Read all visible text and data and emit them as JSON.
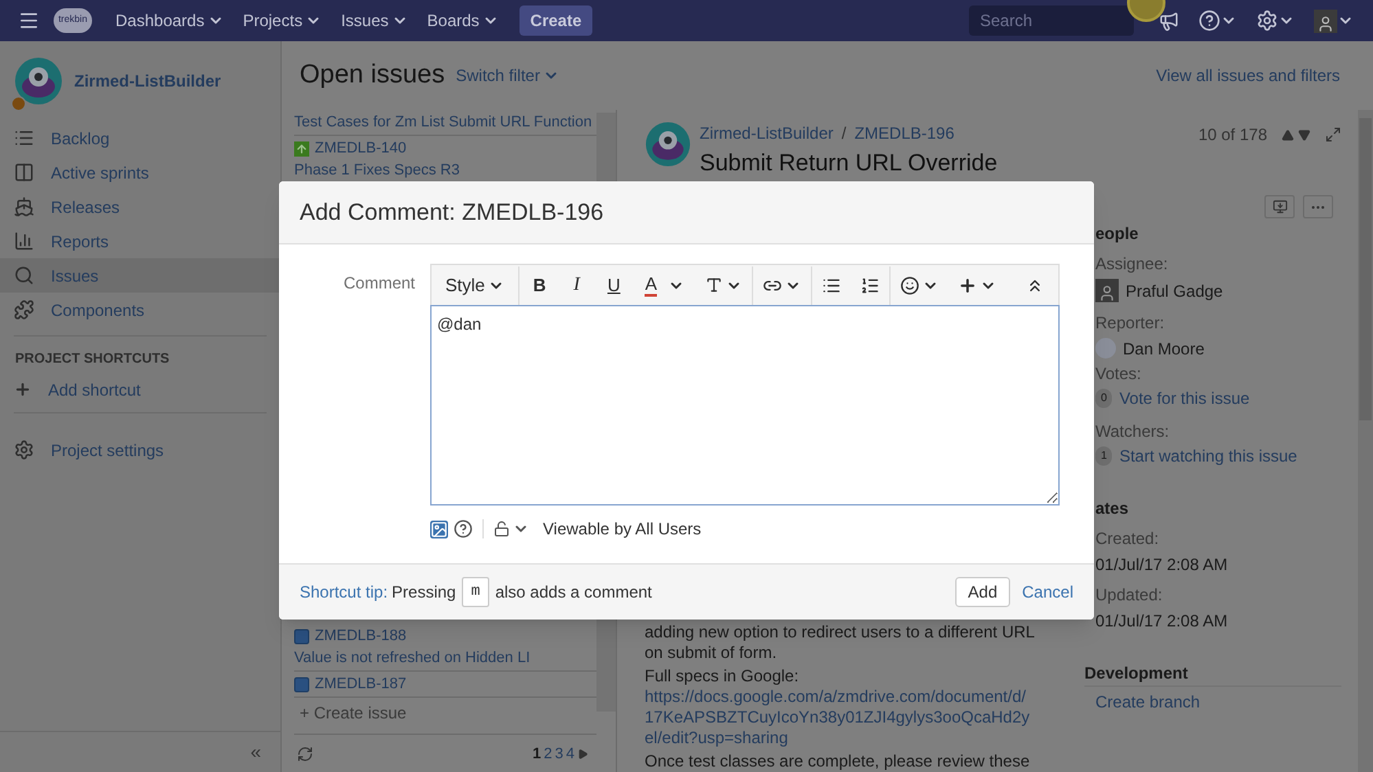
{
  "nav": {
    "logo_text": "trekbin",
    "menus": [
      {
        "label": "Dashboards"
      },
      {
        "label": "Projects"
      },
      {
        "label": "Issues"
      },
      {
        "label": "Boards"
      }
    ],
    "create": "Create",
    "search_placeholder": "Search"
  },
  "sidebar": {
    "project": "Zirmed-ListBuilder",
    "items": [
      {
        "label": "Backlog",
        "selected": false
      },
      {
        "label": "Active sprints",
        "selected": false
      },
      {
        "label": "Releases",
        "selected": false
      },
      {
        "label": "Reports",
        "selected": false
      },
      {
        "label": "Issues",
        "selected": true
      },
      {
        "label": "Components",
        "selected": false
      }
    ],
    "shortcuts_heading": "PROJECT SHORTCUTS",
    "add_shortcut": "Add shortcut",
    "settings": "Project settings",
    "collapse": "«"
  },
  "header": {
    "title": "Open issues",
    "switch_filter": "Switch filter",
    "view_all": "View all issues and filters"
  },
  "issue_list": {
    "top_items": [
      {
        "summary": "Test Cases for Zm List Submit URL Function"
      },
      {
        "key": "ZMEDLB-140",
        "kind": "story",
        "summary": "Phase 1 Fixes Specs R3"
      }
    ],
    "bottom_items": [
      {
        "key": "ZMEDLB-188",
        "kind": "task",
        "summary": "Value is not refreshed on Hidden LI"
      },
      {
        "key": "ZMEDLB-187",
        "kind": "task"
      }
    ],
    "create_issue": "+ Create issue",
    "pages": [
      {
        "label": "1",
        "selected": true
      },
      {
        "label": "2",
        "selected": false
      },
      {
        "label": "3",
        "selected": false
      },
      {
        "label": "4",
        "selected": false
      }
    ]
  },
  "detail": {
    "project": "Zirmed-ListBuilder",
    "separator": "/",
    "key": "ZMEDLB-196",
    "title": "Submit Return URL Override",
    "position": "10 of 178",
    "description": [
      "adding new option to redirect users to a different URL on submit of form.",
      "Full specs in Google:",
      "Once test classes are complete, please review these"
    ],
    "link": "https://docs.google.com/a/zmdrive.com/document/d/17KeAPSBZTCuyIcoYn38y01ZJI4gylys3ooQcaHd2yel/edit?usp=sharing"
  },
  "side": {
    "people_heading": "eople",
    "assignee_label": "Assignee:",
    "assignee": "Praful Gadge",
    "reporter_label": "Reporter:",
    "reporter": "Dan Moore",
    "votes_label": "Votes:",
    "votes_count": "0",
    "vote_link": "Vote for this issue",
    "watchers_label": "Watchers:",
    "watchers_count": "1",
    "watch_link": "Start watching this issue",
    "dates_heading": "ates",
    "created_label": "Created:",
    "created": "01/Jul/17 2:08 AM",
    "updated_label": "Updated:",
    "updated": "01/Jul/17 2:08 AM",
    "development_heading": "Development",
    "create_branch": "Create branch"
  },
  "modal": {
    "title": "Add Comment: ZMEDLB-196",
    "field_label": "Comment",
    "toolbar": [
      {
        "kind": "style",
        "label": "Style"
      },
      {
        "kind": "bold",
        "label": "B"
      },
      {
        "kind": "italic",
        "label": "I"
      },
      {
        "kind": "underline",
        "label": "U"
      },
      {
        "kind": "color",
        "label": "A"
      },
      {
        "kind": "size"
      },
      {
        "kind": "link"
      },
      {
        "kind": "bullets"
      },
      {
        "kind": "numbers"
      },
      {
        "kind": "emoji"
      },
      {
        "kind": "insert"
      },
      {
        "kind": "collapse"
      }
    ],
    "value": "@dan",
    "visibility": "Viewable by All Users",
    "tip_link": "Shortcut tip:",
    "tip_before": "Pressing",
    "tip_key": "m",
    "tip_after": "also adds a comment",
    "add": "Add",
    "cancel": "Cancel"
  }
}
